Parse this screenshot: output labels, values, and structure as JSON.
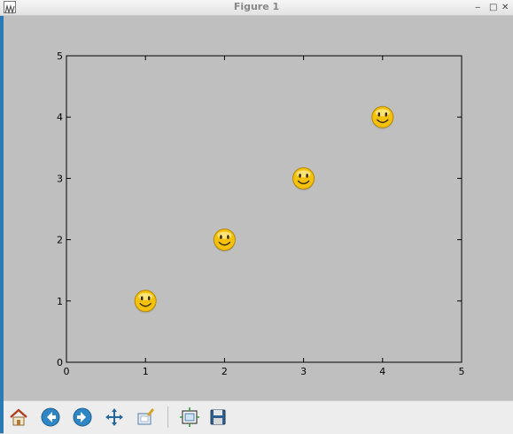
{
  "window": {
    "title": "Figure 1",
    "controls": {
      "minimize": "‒",
      "maximize": "□",
      "close": "✕"
    }
  },
  "chart_data": {
    "type": "scatter",
    "x": [
      1,
      2,
      3,
      4
    ],
    "y": [
      1,
      2,
      3,
      4
    ],
    "marker": "smiley-face-icon",
    "xlim": [
      0,
      5
    ],
    "ylim": [
      0,
      5
    ],
    "xticks": [
      "0",
      "1",
      "2",
      "3",
      "4",
      "5"
    ],
    "yticks": [
      "0",
      "1",
      "2",
      "3",
      "4",
      "5"
    ],
    "title": "",
    "xlabel": "",
    "ylabel": "",
    "grid": false,
    "background": "#bfbfbf"
  },
  "toolbar": {
    "buttons": [
      {
        "name": "home-icon"
      },
      {
        "name": "back-arrow-icon"
      },
      {
        "name": "forward-arrow-icon"
      },
      {
        "name": "pan-move-icon"
      },
      {
        "name": "zoom-rect-icon"
      },
      {
        "name": "subplots-config-icon"
      },
      {
        "name": "save-floppy-icon"
      }
    ]
  },
  "colors": {
    "accent": "#2a7bb5",
    "marker_fill": "#f4c20d"
  }
}
